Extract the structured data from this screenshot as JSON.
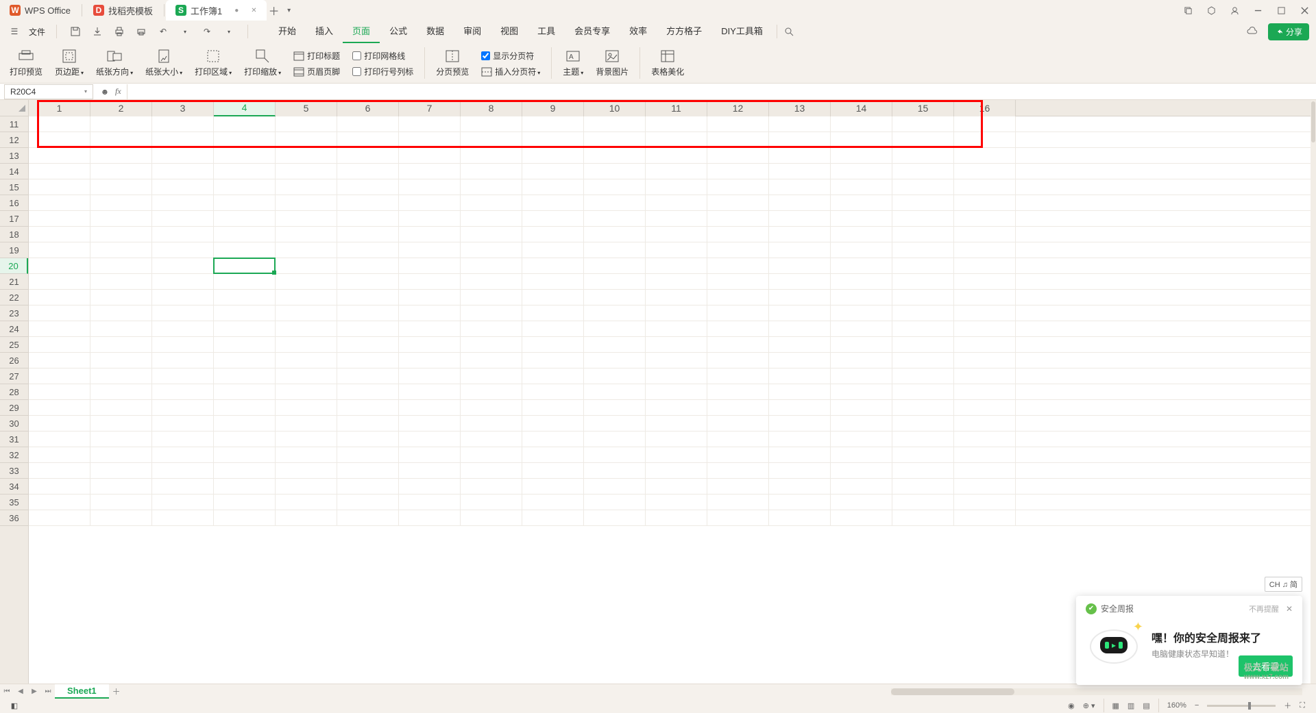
{
  "tabs": {
    "wps": "WPS Office",
    "docer": "找稻壳模板",
    "workbook": "工作簿1"
  },
  "file_menu": "文件",
  "menu": {
    "start": "开始",
    "insert": "插入",
    "page": "页面",
    "formula": "公式",
    "data": "数据",
    "review": "审阅",
    "view": "视图",
    "tools": "工具",
    "vip": "会员专享",
    "effect": "效率",
    "fgz": "方方格子",
    "diy": "DIY工具箱"
  },
  "share": "分享",
  "ribbon": {
    "printpreview": "打印预览",
    "margin": "页边距",
    "orient": "纸张方向",
    "size": "纸张大小",
    "area": "打印区域",
    "scale": "打印缩放",
    "title": "打印标题",
    "grid": "打印网格线",
    "hf": "页眉页脚",
    "rowcol": "打印行号列标",
    "pagepreview": "分页预览",
    "insertbreak": "插入分页符",
    "showbreak": "显示分页符",
    "theme": "主题",
    "bgimg": "背景图片",
    "beautify": "表格美化"
  },
  "namebox": "R20C4",
  "columns": [
    "1",
    "2",
    "3",
    "4",
    "5",
    "6",
    "7",
    "8",
    "9",
    "10",
    "11",
    "12",
    "13",
    "14",
    "15",
    "16"
  ],
  "rows_start": 11,
  "rows_end": 36,
  "active_col": 4,
  "active_row": 20,
  "sheet_tab": "Sheet1",
  "zoom": "160%",
  "popup": {
    "head": "安全周报",
    "noremind": "不再提醒",
    "title": "嘿！你的安全周报来了",
    "sub": "电脑健康状态早知道！",
    "btn": "去看看"
  },
  "ime": "CH ♫ 简",
  "watermark": {
    "l1": "极光下载站",
    "l2": "www.xz7.com"
  }
}
